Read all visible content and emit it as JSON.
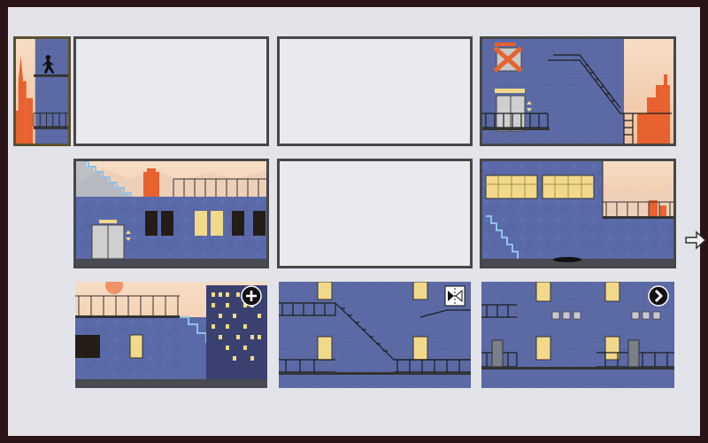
{
  "board": {
    "background": "#e3e4e9",
    "tile_border": "#474747",
    "wall_color": "#5c6ba6",
    "sky_color": "#f3cdb0",
    "city_color": "#e8622f",
    "window_lit": "#f2d98a"
  },
  "tiles": [
    {
      "row": 1,
      "col": 0,
      "state": "current",
      "scene": "runner-on-ledge"
    },
    {
      "row": 1,
      "col": 1,
      "state": "empty"
    },
    {
      "row": 1,
      "col": 2,
      "state": "empty"
    },
    {
      "row": 1,
      "col": 3,
      "state": "filled",
      "scene": "fire-escape-exit-sign"
    },
    {
      "row": 2,
      "col": 1,
      "state": "filled",
      "scene": "rooftop-elevator"
    },
    {
      "row": 2,
      "col": 2,
      "state": "empty"
    },
    {
      "row": 2,
      "col": 3,
      "state": "filled",
      "scene": "skylight-windows"
    },
    {
      "row": 3,
      "col": 1,
      "state": "tray",
      "scene": "rooftop-highrise",
      "button": "add-icon"
    },
    {
      "row": 3,
      "col": 2,
      "state": "tray",
      "scene": "brick-fire-escape",
      "button": "flip-icon"
    },
    {
      "row": 3,
      "col": 3,
      "state": "tray",
      "scene": "balcony-wall",
      "button": "next-icon"
    }
  ],
  "controls": {
    "next_arrow_icon": "arrow-right-icon"
  }
}
